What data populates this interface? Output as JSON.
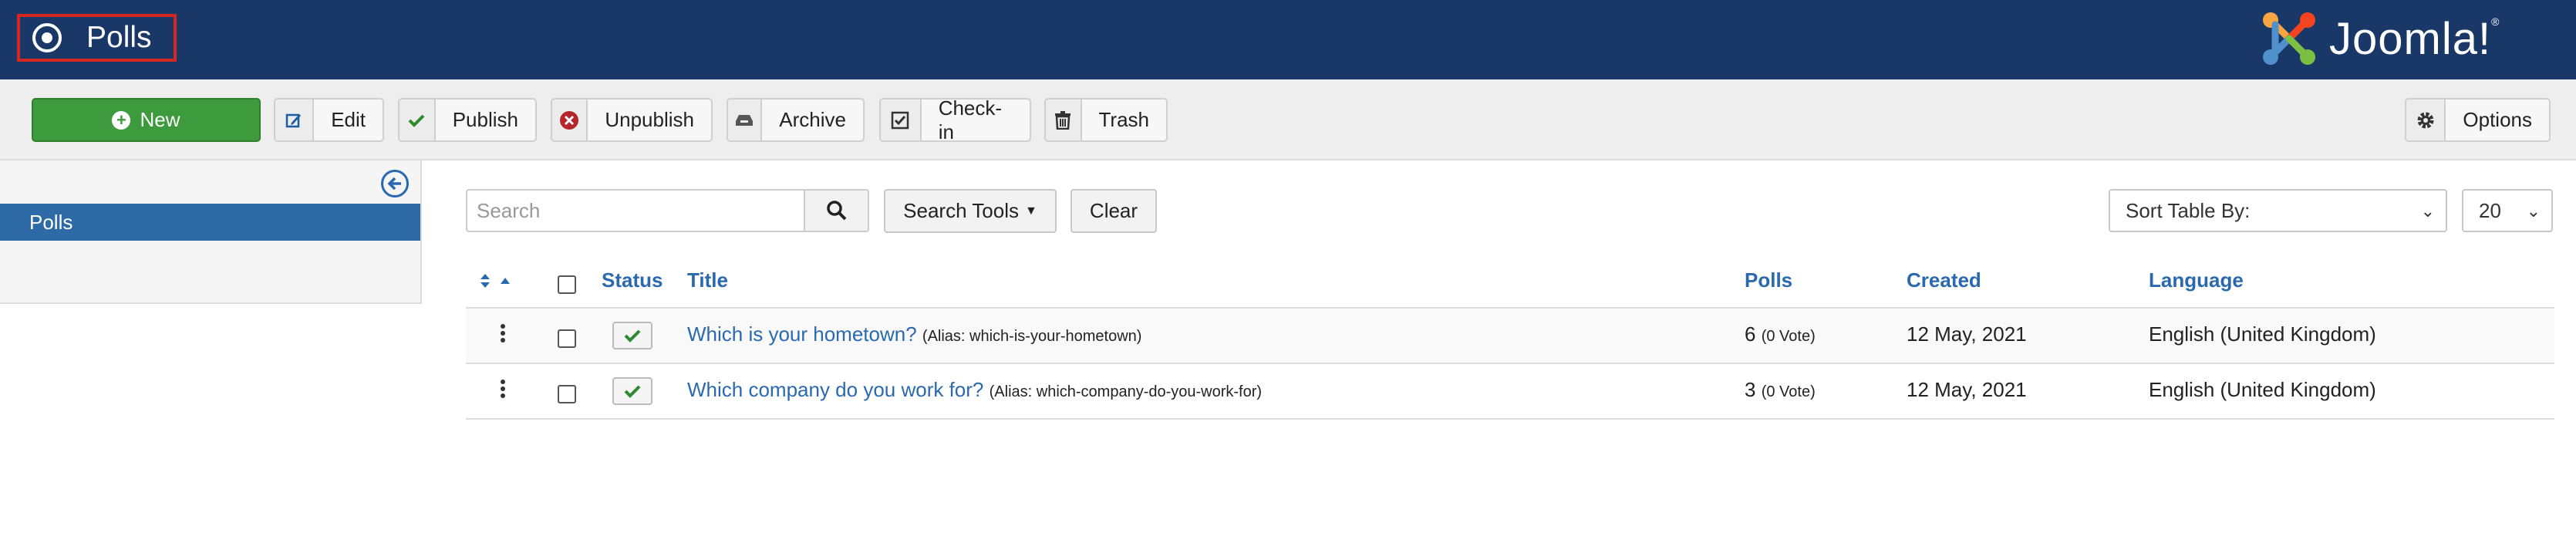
{
  "header": {
    "title": "Polls",
    "title_icon": "radio-circle-icon",
    "logo_text": "Joomla!",
    "logo_mark": "®"
  },
  "toolbar": {
    "new_label": "New",
    "edit_label": "Edit",
    "publish_label": "Publish",
    "unpublish_label": "Unpublish",
    "archive_label": "Archive",
    "checkin_label": "Check-in",
    "trash_label": "Trash",
    "options_label": "Options"
  },
  "sidebar": {
    "items": [
      {
        "label": "Polls",
        "active": true
      }
    ]
  },
  "filters": {
    "search_placeholder": "Search",
    "search_tools_label": "Search Tools",
    "clear_label": "Clear",
    "sort_label": "Sort Table By:",
    "limit_value": "20"
  },
  "table": {
    "columns": {
      "status": "Status",
      "title": "Title",
      "polls": "Polls",
      "created": "Created",
      "language": "Language"
    },
    "rows": [
      {
        "title": "Which is your hometown?",
        "alias": "(Alias: which-is-your-hometown)",
        "polls": "6",
        "votes": "(0 Vote)",
        "created": "12 May, 2021",
        "language": "English (United Kingdom)"
      },
      {
        "title": "Which company do you work for?",
        "alias": "(Alias: which-company-do-you-work-for)",
        "polls": "3",
        "votes": "(0 Vote)",
        "created": "12 May, 2021",
        "language": "English (United Kingdom)"
      }
    ]
  },
  "colors": {
    "header_bg": "#1a3867",
    "accent_link": "#2a69b0",
    "new_button": "#3d9a3d",
    "highlight_box": "#d4271f",
    "sidebar_active": "#2e6aa5"
  }
}
